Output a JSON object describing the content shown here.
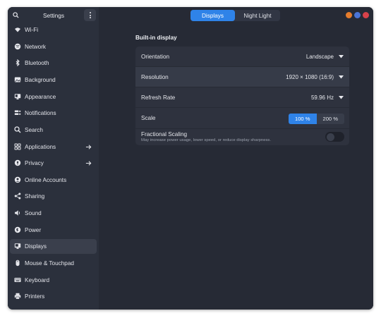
{
  "sidebar": {
    "title": "Settings",
    "items": [
      {
        "label": "Wi-Fi",
        "icon": "wifi-icon",
        "arrow": false,
        "active": false
      },
      {
        "label": "Network",
        "icon": "network-icon",
        "arrow": false,
        "active": false
      },
      {
        "label": "Bluetooth",
        "icon": "bluetooth-icon",
        "arrow": false,
        "active": false
      },
      {
        "label": "Background",
        "icon": "background-icon",
        "arrow": false,
        "active": false
      },
      {
        "label": "Appearance",
        "icon": "appearance-icon",
        "arrow": false,
        "active": false
      },
      {
        "label": "Notifications",
        "icon": "notifications-icon",
        "arrow": false,
        "active": false
      },
      {
        "label": "Search",
        "icon": "search-icon",
        "arrow": false,
        "active": false
      },
      {
        "label": "Applications",
        "icon": "applications-icon",
        "arrow": true,
        "active": false
      },
      {
        "label": "Privacy",
        "icon": "privacy-icon",
        "arrow": true,
        "active": false
      },
      {
        "label": "Online Accounts",
        "icon": "online-accounts-icon",
        "arrow": false,
        "active": false
      },
      {
        "label": "Sharing",
        "icon": "sharing-icon",
        "arrow": false,
        "active": false
      },
      {
        "label": "Sound",
        "icon": "sound-icon",
        "arrow": false,
        "active": false
      },
      {
        "label": "Power",
        "icon": "power-icon",
        "arrow": false,
        "active": false
      },
      {
        "label": "Displays",
        "icon": "displays-icon",
        "arrow": false,
        "active": true
      },
      {
        "label": "Mouse & Touchpad",
        "icon": "mouse-icon",
        "arrow": false,
        "active": false
      },
      {
        "label": "Keyboard",
        "icon": "keyboard-icon",
        "arrow": false,
        "active": false
      },
      {
        "label": "Printers",
        "icon": "printers-icon",
        "arrow": false,
        "active": false
      }
    ]
  },
  "tabs": [
    {
      "label": "Displays",
      "active": true
    },
    {
      "label": "Night Light",
      "active": false
    }
  ],
  "window_controls": {
    "minimize_color": "#e57c2c",
    "maximize_color": "#4a74d6",
    "close_color": "#d7424a"
  },
  "display": {
    "section_title": "Built-in display",
    "orientation": {
      "label": "Orientation",
      "value": "Landscape"
    },
    "resolution": {
      "label": "Resolution",
      "value": "1920 × 1080 (16:9)"
    },
    "refresh_rate": {
      "label": "Refresh Rate",
      "value": "59.96 Hz"
    },
    "scale": {
      "label": "Scale",
      "options": [
        "100 %",
        "200 %"
      ],
      "selected": "100 %"
    },
    "fractional_scaling": {
      "label": "Fractional Scaling",
      "description": "May increase power usage, lower speed, or reduce display sharpness.",
      "enabled": false
    }
  },
  "colors": {
    "accent": "#2f83e8",
    "window_bg": "#262a35",
    "sidebar_bg": "#2b303c"
  }
}
